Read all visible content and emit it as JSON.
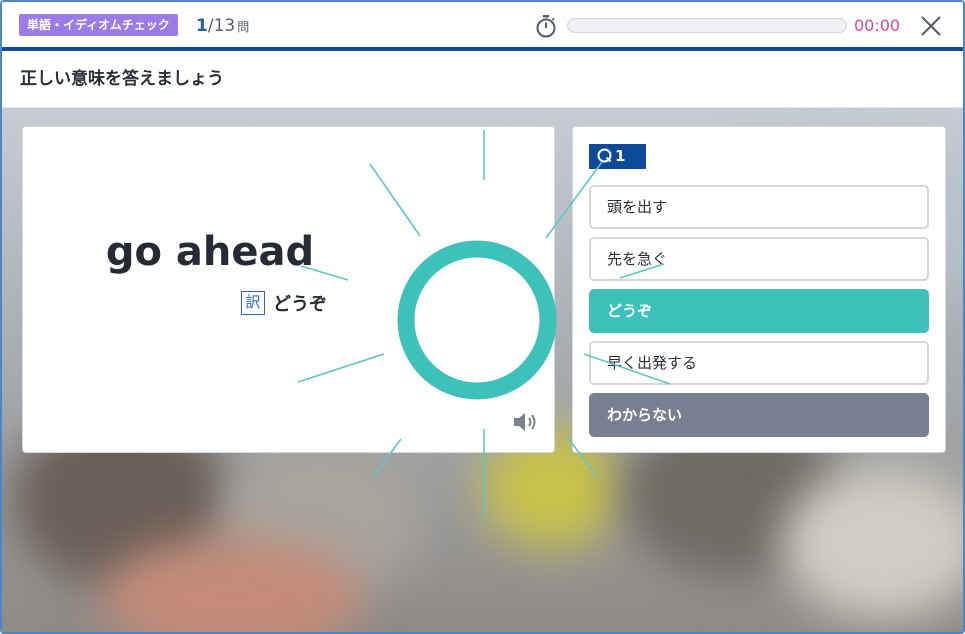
{
  "header": {
    "category": "単語・イディオムチェック",
    "counter_current": "1",
    "counter_total": "/13",
    "counter_unit": "問",
    "progress": 0.0,
    "timer": "00:00"
  },
  "instruction": "正しい意味を答えましょう",
  "word_card": {
    "word": "go ahead",
    "translation_icon": "訳",
    "translation": "どうぞ",
    "sound_icon": "speaker-icon"
  },
  "choices_panel": {
    "question_number": "1",
    "choices": [
      {
        "label": "頭を出す",
        "state": "normal"
      },
      {
        "label": "先を急ぐ",
        "state": "normal"
      },
      {
        "label": "どうぞ",
        "state": "correct"
      },
      {
        "label": "早く出発する",
        "state": "normal"
      },
      {
        "label": "わからない",
        "state": "unknown"
      }
    ]
  },
  "feedback": {
    "result": "correct",
    "mark": "circle"
  },
  "colors": {
    "accent_teal": "#3ec1bb",
    "navy": "#0d4a9a",
    "badge_purple": "#9b7be6",
    "timer_pink": "#e0459a",
    "unknown_gray": "#787f90"
  }
}
